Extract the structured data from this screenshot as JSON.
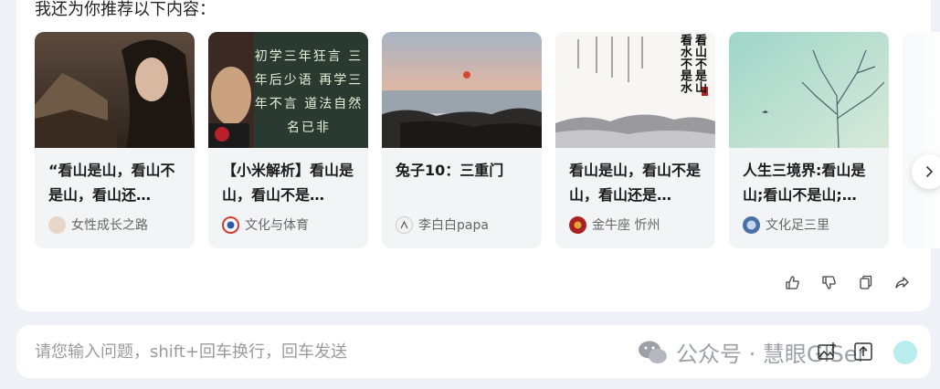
{
  "section_title": "我还为你推荐以下内容：",
  "cards": [
    {
      "title": "“看山是山，看山不是山，看山还…",
      "source": "女性成长之路",
      "avatar_color": "#e8d7c8",
      "thumb_overlay": ""
    },
    {
      "title": "【小米解析】看山是山，看山不是…",
      "source": "文化与体育",
      "avatar_color": "#d63a2f",
      "thumb_overlay": "初学三年狂言 三年后少语 再学三年不言 道法自然名已非"
    },
    {
      "title": "兔子10：三重门",
      "source": "李白白papa",
      "avatar_color": "#f2f2f2",
      "thumb_overlay": ""
    },
    {
      "title": "看山是山，看山不是山，看山还是…",
      "source": "金牛座 忻州",
      "avatar_color": "#a82020",
      "thumb_overlay": "看山不是山 看水不是水"
    },
    {
      "title": "人生三境界:看山是山;看山不是山;…",
      "source": "文化足三里",
      "avatar_color": "#4a6fa5",
      "thumb_overlay": ""
    }
  ],
  "actions": {
    "like_icon": "thumbs-up-icon",
    "dislike_icon": "thumbs-down-icon",
    "copy_icon": "copy-icon",
    "share_icon": "share-icon"
  },
  "input": {
    "placeholder": "请您输入问题，shift+回车换行，回车发送",
    "value": ""
  },
  "watermark": "公众号 · 慧眼GISer"
}
